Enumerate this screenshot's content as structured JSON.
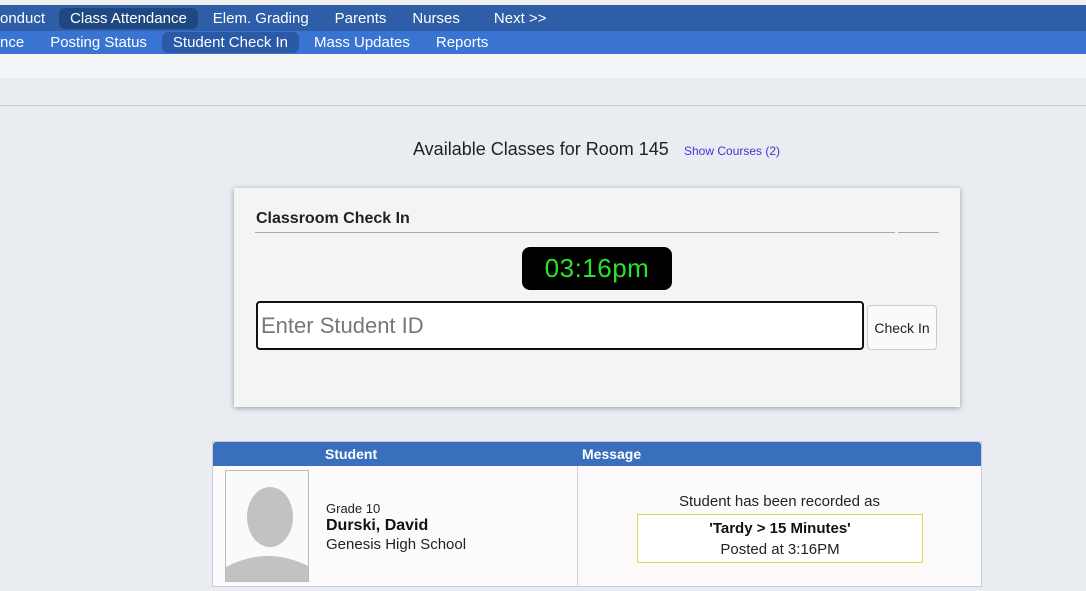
{
  "nav_primary": [
    {
      "label": "onduct",
      "active": false
    },
    {
      "label": "Class Attendance",
      "active": true
    },
    {
      "label": "Elem. Grading",
      "active": false
    },
    {
      "label": "Parents",
      "active": false
    },
    {
      "label": "Nurses",
      "active": false
    },
    {
      "label": "Next >>",
      "active": false
    }
  ],
  "nav_secondary": [
    {
      "label": "nce",
      "active": false
    },
    {
      "label": "Posting Status",
      "active": false
    },
    {
      "label": "Student Check In",
      "active": true
    },
    {
      "label": "Mass Updates",
      "active": false
    },
    {
      "label": "Reports",
      "active": false
    }
  ],
  "page": {
    "title": "Available Classes for Room 145",
    "show_courses": "Show Courses (2)"
  },
  "checkin": {
    "title": "Classroom Check In",
    "clock": "03:16pm",
    "input_placeholder": "Enter Student ID",
    "input_value": "",
    "button_label": "Check In"
  },
  "results": {
    "headers": {
      "student": "Student",
      "message": "Message"
    },
    "rows": [
      {
        "grade": "Grade 10",
        "name": "Durski, David",
        "school": "Genesis High School",
        "message": "Student has been recorded as",
        "status": "'Tardy > 15 Minutes'",
        "posted": "Posted at 3:16PM"
      }
    ]
  },
  "colors": {
    "nav_primary_bg": "#2e5ea8",
    "nav_secondary_bg": "#3a74d3",
    "table_header_bg": "#3a6fbd",
    "clock_text": "#2ee02e",
    "link": "#4a2fd0"
  },
  "icons": {
    "avatar": "default-person-silhouette-icon"
  }
}
